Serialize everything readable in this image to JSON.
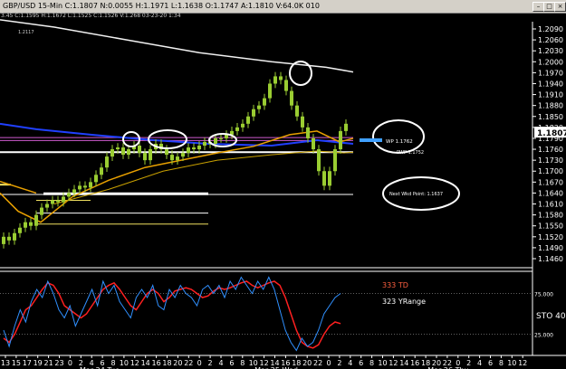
{
  "window": {
    "title": "GBP/USD 15-Min  C:1.1807  N:0.0055  H:1.1971  L:1.1638  O:1.1747  A:1.1810  V:64.0K  010",
    "buttons": [
      "–",
      "□",
      "×"
    ]
  },
  "info_line": "3.45  C:1.1595  H:1.1672  L:1.1525  C:1.1526  V:1.268  03-23-20  1:34",
  "price_axis": {
    "ticks": [
      "1.2090",
      "1.2060",
      "1.2030",
      "1.2000",
      "1.1970",
      "1.1940",
      "1.1910",
      "1.1880",
      "1.1850",
      "1.1820",
      "1.1790",
      "1.1760",
      "1.1730",
      "1.1700",
      "1.1670",
      "1.1640",
      "1.1610",
      "1.1580",
      "1.1550",
      "1.1520",
      "1.1490",
      "1.1460"
    ],
    "current_price": "1.1807"
  },
  "osc_axis": {
    "ticks": [
      "75.000",
      "25.000"
    ],
    "label": "STO"
  },
  "time_axis": {
    "ticks": [
      "13",
      "15",
      "17",
      "19",
      "21",
      "23",
      "0",
      "2",
      "4",
      "6",
      "8",
      "10",
      "12",
      "14",
      "16",
      "18",
      "20",
      "22",
      "0",
      "2",
      "4",
      "6",
      "8",
      "10",
      "12",
      "14",
      "16",
      "18",
      "20",
      "22",
      "0",
      "2",
      "4",
      "6",
      "8",
      "10",
      "12",
      "14",
      "16",
      "18",
      "20",
      "22",
      "0",
      "2",
      "4",
      "6",
      "8",
      "10",
      "12"
    ],
    "dates": [
      "Mar 24 Tue",
      "Mar 25 Wed",
      "Mar 26 Thu"
    ]
  },
  "annotations": {
    "wp_label": "WP 1.1762",
    "pivot_label": "PWP 1.1752",
    "next_pivot": "Next Wkd Point: 1.1637",
    "td_label": "333 TD",
    "yrange_label": "323 YRange",
    "top_marker": "1.2117"
  },
  "colors": {
    "background": "#000000",
    "candle": "#9acd32",
    "ma_white": "#f0f0f0",
    "ma_orange": "#e8a000",
    "ma_blue": "#2040ff",
    "ma_magenta": "#d040d0",
    "osc_red": "#ff2020",
    "osc_blue": "#3090ff",
    "arrow": "#40a0ff"
  }
}
